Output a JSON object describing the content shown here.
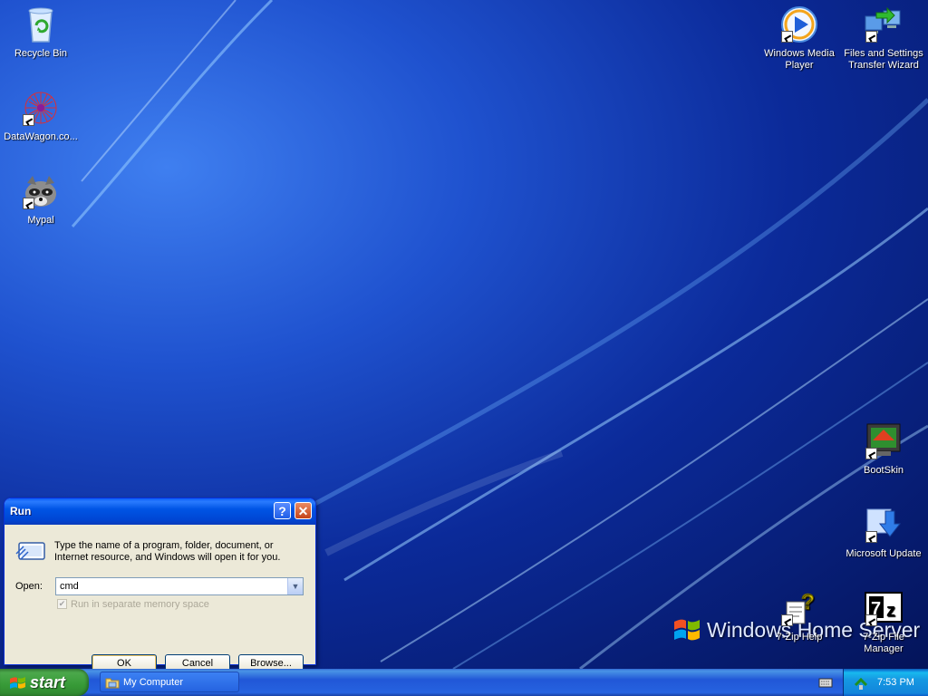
{
  "desktop": {
    "icons": {
      "recycle_bin": "Recycle Bin",
      "datawagon": "DataWagon.co...",
      "mypal": "Mypal",
      "wmp_line1": "Windows Media",
      "wmp_line2": "Player",
      "fast_line1": "Files and Settings",
      "fast_line2": "Transfer Wizard",
      "bootskin": "BootSkin",
      "microsoft_update": "Microsoft Update",
      "zip_help": "7-Zip Help",
      "zip_fm": "7-Zip File Manager"
    },
    "logo_text": "Windows Home Server"
  },
  "run_dialog": {
    "title": "Run",
    "description": "Type the name of a program, folder, document, or Internet resource, and Windows will open it for you.",
    "open_label": "Open:",
    "open_value": "cmd",
    "separate_memory_label": "Run in separate memory space",
    "separate_memory_checked": true,
    "ok_label": "OK",
    "cancel_label": "Cancel",
    "browse_label": "Browse..."
  },
  "taskbar": {
    "start_label": "start",
    "tasks": [
      {
        "label": "My Computer",
        "icon": "my-computer-icon"
      }
    ],
    "clock": "7:53 PM"
  },
  "colors": {
    "taskbar_blue": "#245edb",
    "start_green": "#3c9a3c",
    "dialog_face": "#ece9d8",
    "titlebar_blue": "#0055e5"
  }
}
